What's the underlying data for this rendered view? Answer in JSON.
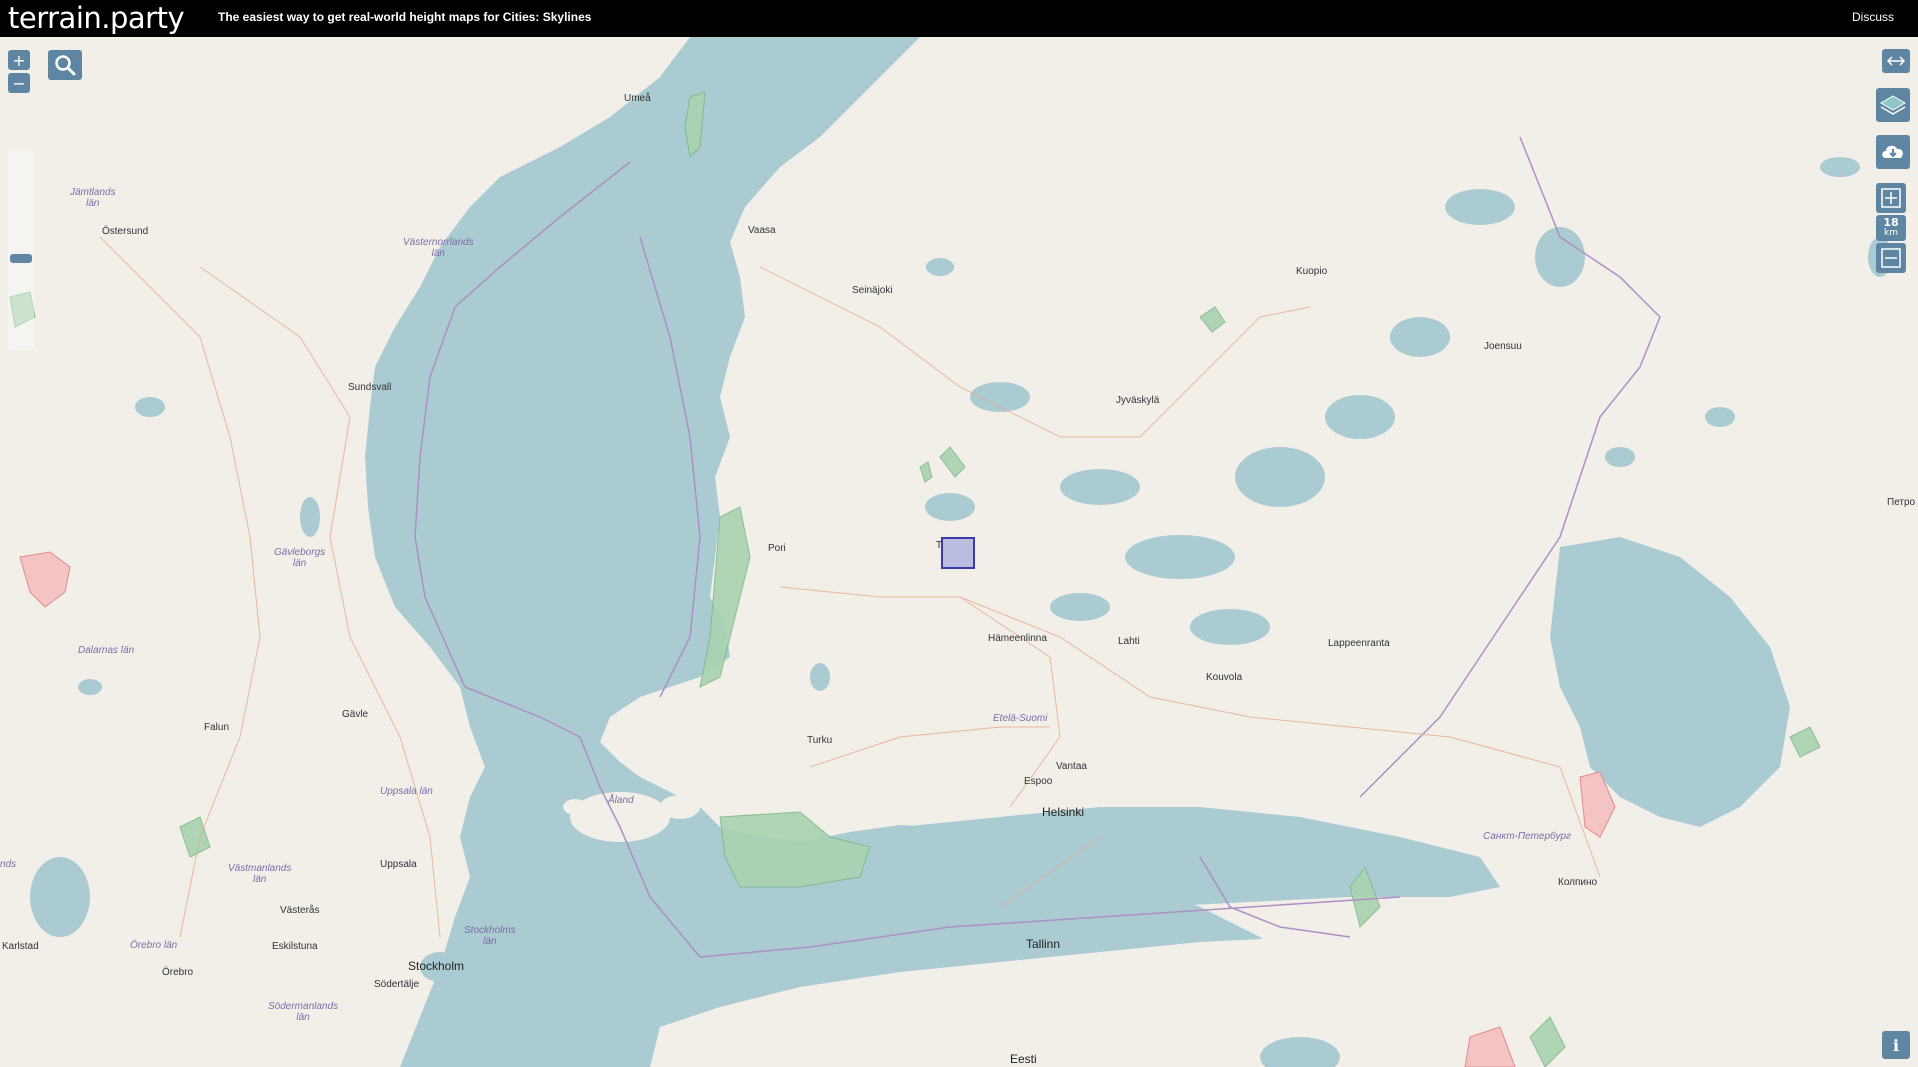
{
  "header": {
    "logo": "terrain.party",
    "tagline_prefix": "The easiest way to get real-world height maps for ",
    "tagline_game": "Cities: Skylines",
    "discuss_label": "Discuss"
  },
  "controls": {
    "zoom_in": "+",
    "zoom_out": "−",
    "scale_value": "18",
    "scale_unit": "km",
    "info": "i"
  },
  "icons": [
    "search-icon",
    "resize-arrows-icon",
    "layers-icon",
    "cloud-download-icon",
    "square-plus-icon",
    "square-minus-icon",
    "info-icon"
  ],
  "colors": {
    "water": "#aacbd1",
    "land": "#f2efe9",
    "boundary": "#ad8fc6",
    "road": "#e8a98c",
    "forest": "#a8d3b0",
    "military": "#f09c9c",
    "selection": "#3a3aa8"
  },
  "labels": {
    "umea": "Umeå",
    "vaasa": "Vaasa",
    "seinajoki": "Seinäjoki",
    "kuopio": "Kuopio",
    "joensuu": "Joensuu",
    "jyvaskyla": "Jyväskylä",
    "jamtlands": "Jämtlands\nlän",
    "ostersund": "Östersund",
    "vasternorrlands": "Västernorrlands\nlän",
    "sundsvall": "Sundsvall",
    "pori": "Pori",
    "tampere": "T",
    "gavleborgs": "Gävleborgs\nlän",
    "dalarnas": "Dalarnas län",
    "hameenlinna": "Hämeenlinna",
    "lahti": "Lahti",
    "lappeenranta": "Lappeenranta",
    "kouvola": "Kouvola",
    "gavle": "Gävle",
    "falun": "Falun",
    "turku": "Turku",
    "etela_suomi": "Etelä-Suomi",
    "vantaa": "Vantaa",
    "espoo": "Espoo",
    "helsinki": "Helsinki",
    "uppsala_lan": "Uppsala län",
    "aland": "Åland",
    "vastmanlands": "Västmanlands\nlän",
    "uppsala": "Uppsala",
    "vasteras": "Västerås",
    "stockholms_lan": "Stockholms\nlän",
    "orebro_lan": "Örebro län",
    "eskilstuna": "Eskilstuna",
    "karlstad": "Karlstad",
    "orebro": "Örebro",
    "stockholm": "Stockholm",
    "sodertalje": "Södertälje",
    "sodermanlands": "Södermanlands\nlän",
    "tallinn": "Tallinn",
    "eesti": "Eesti",
    "sankt_peterburg": "Санкт-Петербург",
    "kolpino": "Колпино",
    "petro": "Петро",
    "lands": "nds"
  }
}
